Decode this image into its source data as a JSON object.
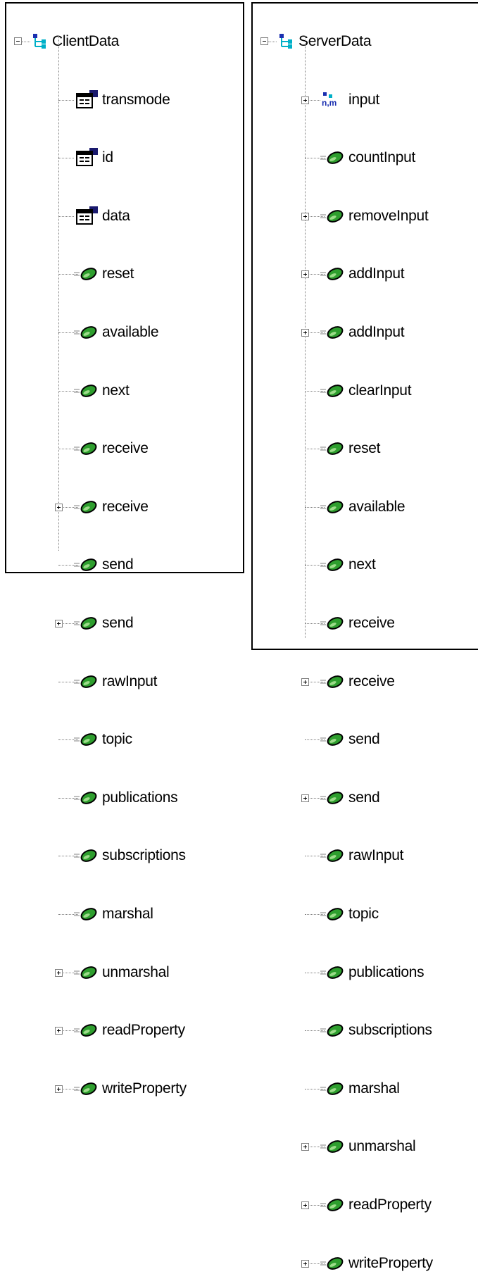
{
  "left_tree": {
    "root": {
      "label": "ClientData",
      "expanded": true,
      "icon": "class-icon"
    },
    "children": [
      {
        "label": "transmode",
        "icon": "property-icon",
        "expandable": false
      },
      {
        "label": "id",
        "icon": "property-icon",
        "expandable": false
      },
      {
        "label": "data",
        "icon": "property-icon",
        "expandable": false
      },
      {
        "label": "reset",
        "icon": "method-icon",
        "expandable": false
      },
      {
        "label": "available",
        "icon": "method-icon",
        "expandable": false
      },
      {
        "label": "next",
        "icon": "method-icon",
        "expandable": false
      },
      {
        "label": "receive",
        "icon": "method-icon",
        "expandable": false
      },
      {
        "label": "receive",
        "icon": "method-icon",
        "expandable": true
      },
      {
        "label": "send",
        "icon": "method-icon",
        "expandable": false
      },
      {
        "label": "send",
        "icon": "method-icon",
        "expandable": true
      },
      {
        "label": "rawInput",
        "icon": "method-icon",
        "expandable": false
      },
      {
        "label": "topic",
        "icon": "method-icon",
        "expandable": false
      },
      {
        "label": "publications",
        "icon": "method-icon",
        "expandable": false
      },
      {
        "label": "subscriptions",
        "icon": "method-icon",
        "expandable": false
      },
      {
        "label": "marshal",
        "icon": "method-icon",
        "expandable": false
      },
      {
        "label": "unmarshal",
        "icon": "method-icon",
        "expandable": true
      },
      {
        "label": "readProperty",
        "icon": "method-icon",
        "expandable": true
      },
      {
        "label": "writeProperty",
        "icon": "method-icon",
        "expandable": true
      }
    ]
  },
  "right_tree": {
    "root": {
      "label": "ServerData",
      "expanded": true,
      "icon": "class-icon"
    },
    "children": [
      {
        "label": "input",
        "icon": "collection-icon",
        "expandable": true
      },
      {
        "label": "countInput",
        "icon": "method-icon",
        "expandable": false
      },
      {
        "label": "removeInput",
        "icon": "method-icon",
        "expandable": true
      },
      {
        "label": "addInput",
        "icon": "method-icon",
        "expandable": true
      },
      {
        "label": "addInput",
        "icon": "method-icon",
        "expandable": true
      },
      {
        "label": "clearInput",
        "icon": "method-icon",
        "expandable": false
      },
      {
        "label": "reset",
        "icon": "method-icon",
        "expandable": false
      },
      {
        "label": "available",
        "icon": "method-icon",
        "expandable": false
      },
      {
        "label": "next",
        "icon": "method-icon",
        "expandable": false
      },
      {
        "label": "receive",
        "icon": "method-icon",
        "expandable": false
      },
      {
        "label": "receive",
        "icon": "method-icon",
        "expandable": true
      },
      {
        "label": "send",
        "icon": "method-icon",
        "expandable": false
      },
      {
        "label": "send",
        "icon": "method-icon",
        "expandable": true
      },
      {
        "label": "rawInput",
        "icon": "method-icon",
        "expandable": false
      },
      {
        "label": "topic",
        "icon": "method-icon",
        "expandable": false
      },
      {
        "label": "publications",
        "icon": "method-icon",
        "expandable": false
      },
      {
        "label": "subscriptions",
        "icon": "method-icon",
        "expandable": false
      },
      {
        "label": "marshal",
        "icon": "method-icon",
        "expandable": false
      },
      {
        "label": "unmarshal",
        "icon": "method-icon",
        "expandable": true
      },
      {
        "label": "readProperty",
        "icon": "method-icon",
        "expandable": true
      },
      {
        "label": "writeProperty",
        "icon": "method-icon",
        "expandable": true
      }
    ]
  },
  "colors": {
    "method_green": "#2e9e2e",
    "class_blue": "#1a2fb0",
    "class_cyan": "#00b0c8"
  }
}
